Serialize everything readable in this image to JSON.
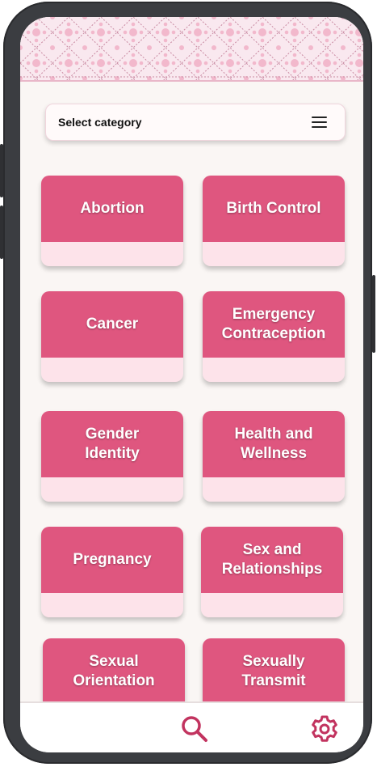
{
  "header": {
    "select_label": "Select category",
    "menu_icon": "hamburger-menu-icon"
  },
  "categories": [
    {
      "label": "Abortion"
    },
    {
      "label": "Birth Control"
    },
    {
      "label": "Cancer"
    },
    {
      "label": "Emergency Contraception"
    },
    {
      "label": "Gender Identity"
    },
    {
      "label": "Health and Wellness"
    },
    {
      "label": "Pregnancy"
    },
    {
      "label": "Sex and Relationships"
    },
    {
      "label": "Sexual Orientation"
    },
    {
      "label": "Sexually Transmit"
    }
  ],
  "bottom_nav": {
    "search_icon": "search-icon",
    "settings_icon": "gear-icon"
  },
  "colors": {
    "tile_top": "#df567f",
    "tile_bottom": "#fde3ea",
    "screen_bg": "#faf6f4",
    "icon_accent": "#c2335f"
  }
}
